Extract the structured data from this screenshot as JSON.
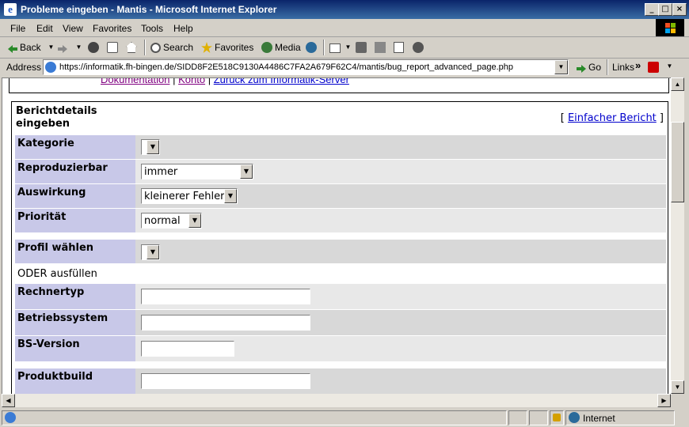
{
  "window": {
    "title": "Probleme eingeben - Mantis - Microsoft Internet Explorer",
    "app_icon": "e",
    "minimize": "_",
    "maximize": "□",
    "close": "×"
  },
  "menu": [
    "File",
    "Edit",
    "View",
    "Favorites",
    "Tools",
    "Help"
  ],
  "toolbar": {
    "back": "Back",
    "search": "Search",
    "favorites": "Favorites",
    "media": "Media"
  },
  "address": {
    "label": "Address",
    "url": "https://informatik.fh-bingen.de/SIDD8F2E518C9130A4486C7FA2A679F62C4/mantis/bug_report_advanced_page.php",
    "go": "Go",
    "links": "Links",
    "more": "»"
  },
  "page": {
    "toplinks": {
      "doc": "Dokumentation",
      "sep1": "|",
      "konto": "Konto",
      "sep2": "|",
      "server": "Zurück zum Informatik-Server"
    },
    "form_title": "Berichtdetails eingeben",
    "simple_link": "Einfacher Bericht",
    "bracket_open": "[",
    "bracket_close": "]",
    "rows": {
      "kategorie": {
        "label": "Kategorie",
        "value": ""
      },
      "reproduzierbar": {
        "label": "Reproduzierbar",
        "value": "immer"
      },
      "auswirkung": {
        "label": "Auswirkung",
        "value": "kleinerer Fehler"
      },
      "prioritaet": {
        "label": "Priorität",
        "value": "normal"
      },
      "profil": {
        "label": "Profil wählen",
        "value": ""
      },
      "oder": {
        "text": "ODER ausfüllen"
      },
      "rechnertyp": {
        "label": "Rechnertyp",
        "value": ""
      },
      "betriebssystem": {
        "label": "Betriebssystem",
        "value": ""
      },
      "bsversion": {
        "label": "BS-Version",
        "value": ""
      },
      "produktbuild": {
        "label": "Produktbuild",
        "value": ""
      }
    }
  },
  "status": {
    "zone": "Internet"
  },
  "colors": {
    "label_bg": "#c8c8e8",
    "row_bg1": "#d8d8d8",
    "row_bg2": "#e8e8e8",
    "link": "#0000cc"
  }
}
